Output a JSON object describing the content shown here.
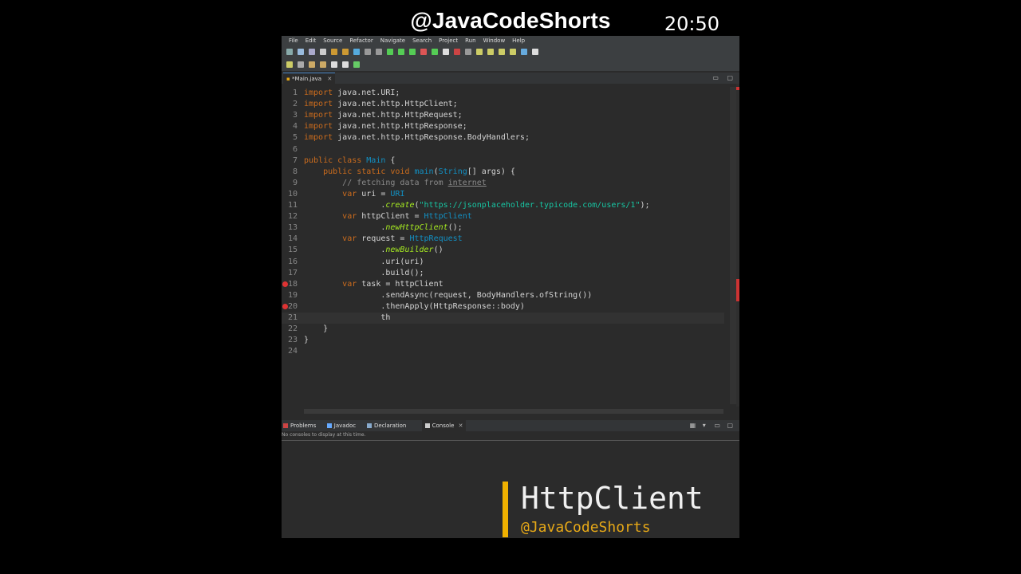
{
  "channel": "@JavaCodeShorts",
  "timer": "20:50",
  "menu": [
    "File",
    "Edit",
    "Source",
    "Refactor",
    "Navigate",
    "Search",
    "Project",
    "Run",
    "Window",
    "Help"
  ],
  "editor_tab": {
    "label": "*Main.java",
    "close": "✕"
  },
  "code": [
    {
      "n": "1",
      "html": "<span class='kw'>import</span> java.net.URI;"
    },
    {
      "n": "2",
      "html": "<span class='kw'>import</span> java.net.http.HttpClient;"
    },
    {
      "n": "3",
      "html": "<span class='kw'>import</span> java.net.http.HttpRequest;"
    },
    {
      "n": "4",
      "html": "<span class='kw'>import</span> java.net.http.HttpResponse;"
    },
    {
      "n": "5",
      "html": "<span class='kw'>import</span> java.net.http.HttpResponse.BodyHandlers;"
    },
    {
      "n": "6",
      "html": ""
    },
    {
      "n": "7",
      "html": "<span class='kw'>public class</span> <span class='ty'>Main</span> {"
    },
    {
      "n": "8",
      "html": "    <span class='kw'>public static void</span> <span class='ty'>main</span>(<span class='ty'>String</span>[] args) {"
    },
    {
      "n": "9",
      "html": "        <span class='cm'>// fetching data from <u>internet</u></span>"
    },
    {
      "n": "10",
      "html": "        <span class='kw'>var</span> uri = <span class='ty'>URI</span>"
    },
    {
      "n": "11",
      "html": "                .<span class='mth'>create</span>(<span class='str'>\"https://jsonplaceholder.typicode.com/users/1\"</span>);"
    },
    {
      "n": "12",
      "html": "        <span class='kw'>var</span> httpClient = <span class='ty'>HttpClient</span>"
    },
    {
      "n": "13",
      "html": "                .<span class='mth'>newHttpClient</span>();"
    },
    {
      "n": "14",
      "html": "        <span class='kw'>var</span> request = <span class='ty'>HttpRequest</span>"
    },
    {
      "n": "15",
      "html": "                .<span class='mth'>newBuilder</span>()"
    },
    {
      "n": "16",
      "html": "                .uri(uri)"
    },
    {
      "n": "17",
      "html": "                .build();"
    },
    {
      "n": "18",
      "html": "        <span class='kw'>var</span> task = httpClient"
    },
    {
      "n": "19",
      "html": "                .sendAsync(request, BodyHandlers.ofString())"
    },
    {
      "n": "20",
      "html": "                .thenApply(HttpResponse::body)"
    },
    {
      "n": "21",
      "html": "                th"
    },
    {
      "n": "22",
      "html": "    }"
    },
    {
      "n": "23",
      "html": "}"
    },
    {
      "n": "24",
      "html": ""
    }
  ],
  "bottom_tabs": [
    {
      "label": "Problems",
      "color": "#c44"
    },
    {
      "label": "Javadoc",
      "color": "#6af"
    },
    {
      "label": "Declaration",
      "color": "#8ac"
    },
    {
      "label": "Console",
      "color": "#ccc"
    }
  ],
  "console_close": "✕",
  "console_message": "No consoles to display at this time.",
  "overlay": {
    "title": "HttpClient",
    "subtitle": "@JavaCodeShorts"
  }
}
